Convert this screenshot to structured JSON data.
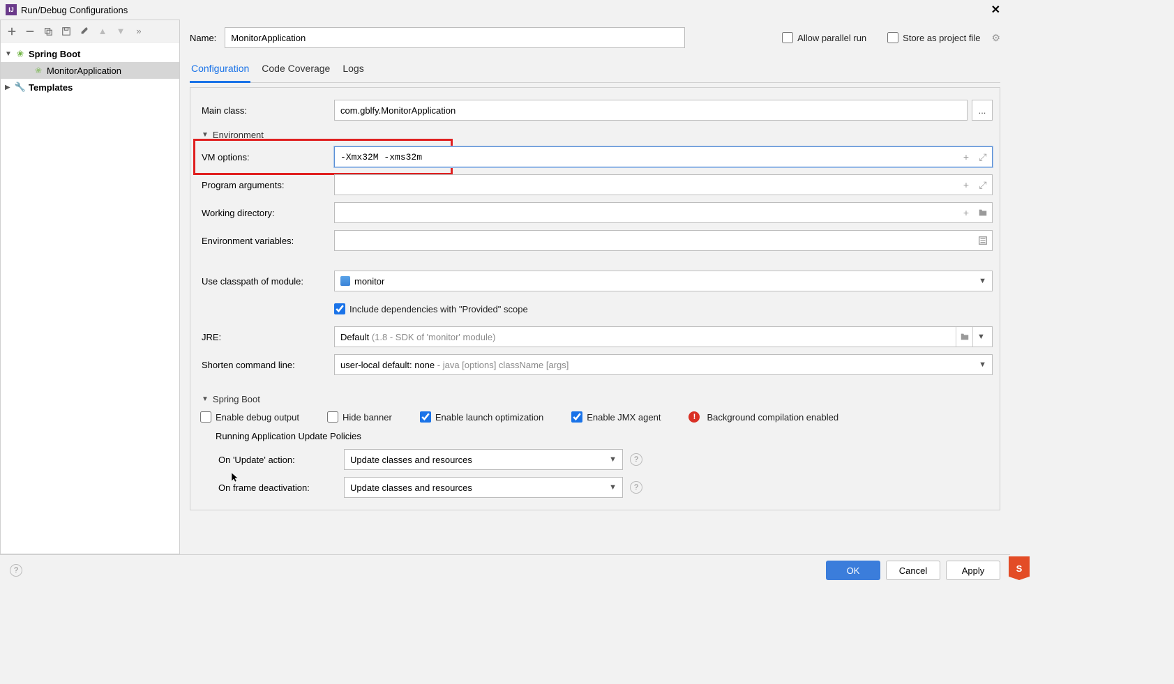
{
  "title": "Run/Debug Configurations",
  "sidebar": {
    "items": [
      {
        "label": "Spring Boot"
      },
      {
        "label": "MonitorApplication"
      },
      {
        "label": "Templates"
      }
    ]
  },
  "header": {
    "name_label": "Name:",
    "name_value": "MonitorApplication",
    "allow_parallel": "Allow parallel run",
    "store_project": "Store as project file"
  },
  "tabs": {
    "configuration": "Configuration",
    "code_coverage": "Code Coverage",
    "logs": "Logs"
  },
  "form": {
    "main_class_label": "Main class:",
    "main_class_value": "com.gblfy.MonitorApplication",
    "browse_ellipsis": "...",
    "environment_section": "Environment",
    "vm_options_label": "VM options:",
    "vm_options_value": "-Xmx32M -xms32m",
    "program_args_label": "Program arguments:",
    "program_args_value": "",
    "working_dir_label": "Working directory:",
    "working_dir_value": "",
    "env_vars_label": "Environment variables:",
    "env_vars_value": "",
    "classpath_label": "Use classpath of module:",
    "classpath_value": "monitor",
    "include_deps": "Include dependencies with \"Provided\" scope",
    "jre_label": "JRE:",
    "jre_default": "Default",
    "jre_detail": " (1.8 - SDK of 'monitor' module)",
    "shorten_label": "Shorten command line:",
    "shorten_value": "user-local default: none",
    "shorten_detail": " - java [options] className [args]"
  },
  "spring": {
    "section": "Spring Boot",
    "enable_debug": "Enable debug output",
    "hide_banner": "Hide banner",
    "enable_launch": "Enable launch optimization",
    "enable_jmx": "Enable JMX agent",
    "bg_compile": "Background compilation enabled",
    "running_policies": "Running Application Update Policies",
    "on_update_label": "On 'Update' action:",
    "on_update_value": "Update classes and resources",
    "on_frame_label": "On frame deactivation:",
    "on_frame_value": "Update classes and resources"
  },
  "footer": {
    "ok": "OK",
    "cancel": "Cancel",
    "apply": "Apply"
  }
}
